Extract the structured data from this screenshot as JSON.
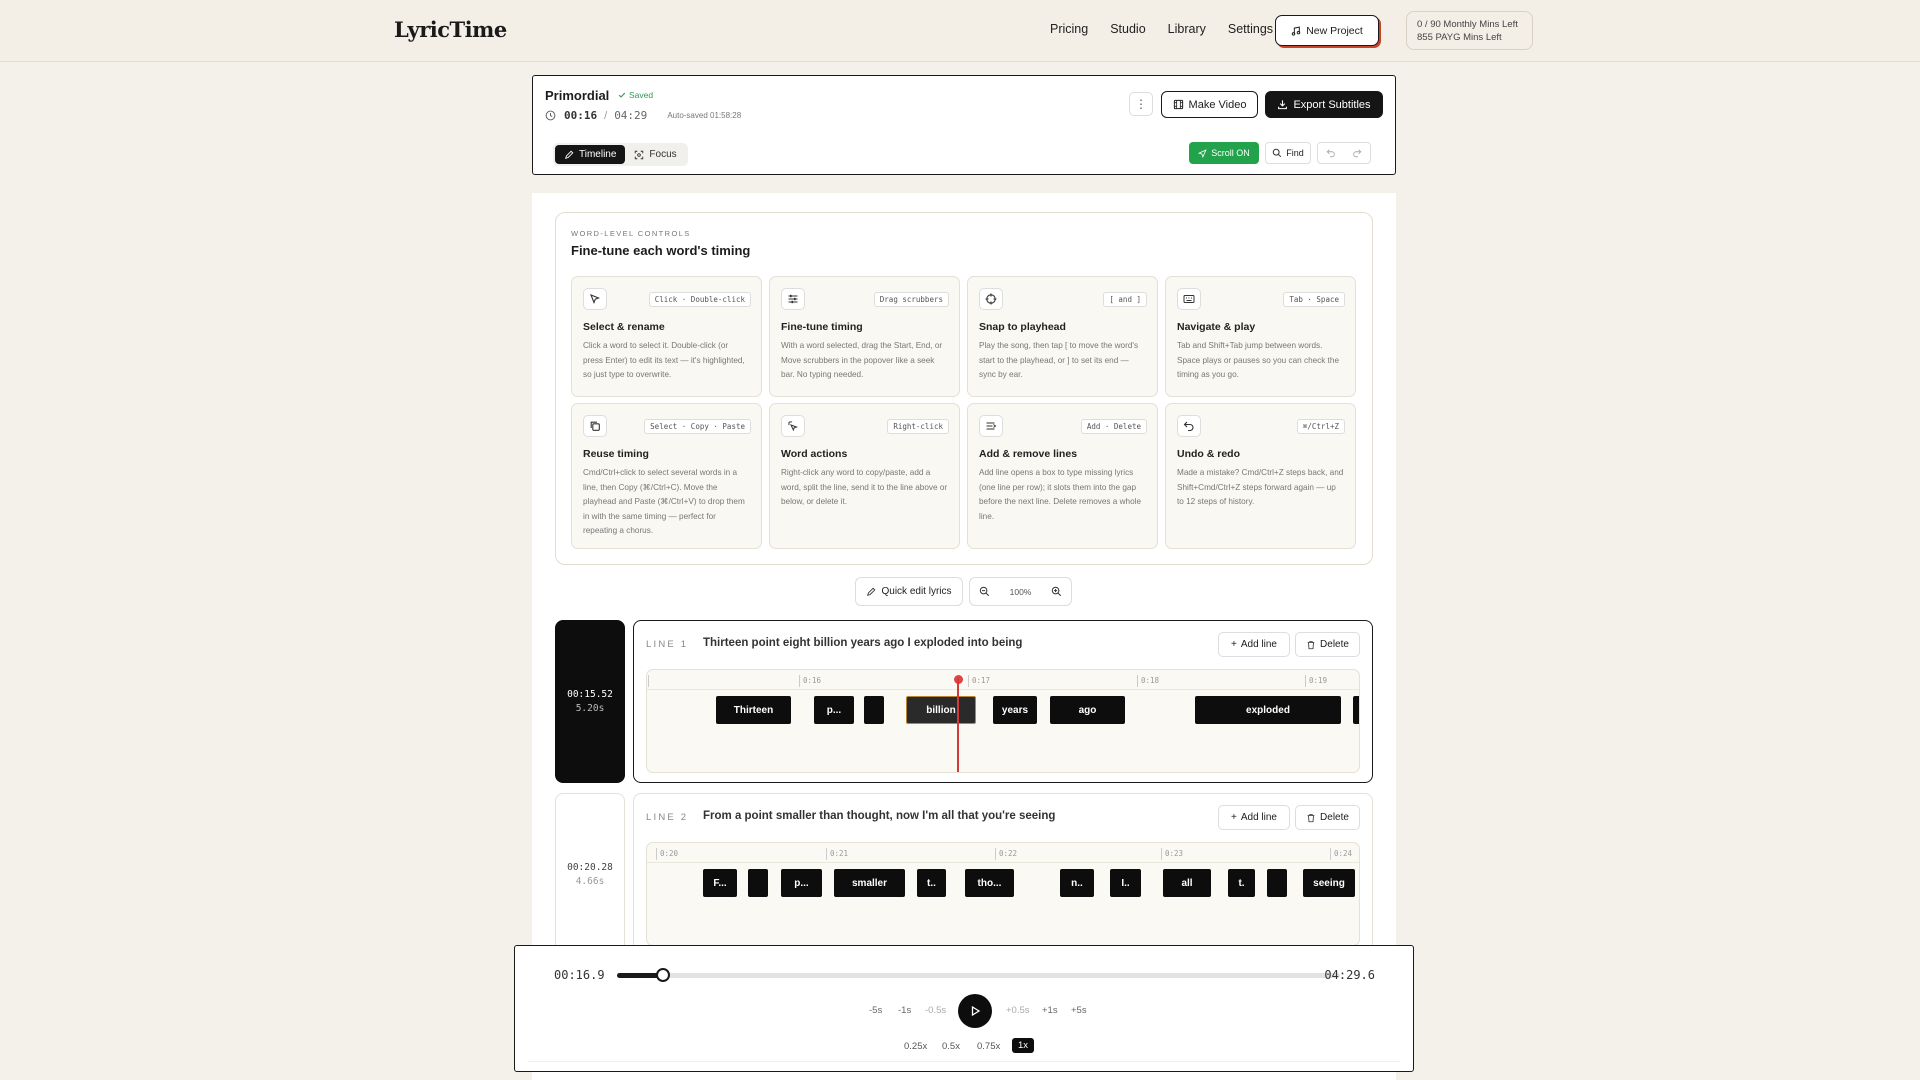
{
  "app": {
    "logo": "LyricTime"
  },
  "nav": {
    "links": [
      "Pricing",
      "Studio",
      "Library",
      "Settings"
    ],
    "new_project": "New Project",
    "mins_monthly": "0 / 90 Monthly Mins Left",
    "mins_payg": "855 PAYG Mins Left"
  },
  "project": {
    "title": "Primordial",
    "saved": "Saved",
    "current_time": "00:16",
    "separator": "/",
    "duration": "04:29",
    "autosaved": "Auto-saved 01:58:28"
  },
  "toolbar": {
    "make_video": "Make Video",
    "export": "Export Subtitles",
    "modes": [
      "Timeline",
      "Focus"
    ],
    "scroll": "Scroll  ON",
    "find": "Find"
  },
  "controls": {
    "eyebrow": "WORD-LEVEL CONTROLS",
    "title": "Fine-tune each word's timing",
    "tiles": [
      {
        "icon": "cursor-icon",
        "key": "Click · Double-click",
        "title": "Select & rename",
        "desc": "Click a word to select it. Double-click (or press Enter) to edit its text — it's highlighted, so just type to overwrite."
      },
      {
        "icon": "sliders-icon",
        "key": "Drag scrubbers",
        "title": "Fine-tune timing",
        "desc": "With a word selected, drag the Start, End, or Move scrubbers in the popover like a seek bar. No typing needed."
      },
      {
        "icon": "crosshair-icon",
        "key": "[ and ]",
        "title": "Snap to playhead",
        "desc": "Play the song, then tap [ to move the word's start to the playhead, or ] to set its end — sync by ear."
      },
      {
        "icon": "keyboard-icon",
        "key": "Tab · Space",
        "title": "Navigate & play",
        "desc": "Tab and Shift+Tab jump between words. Space plays or pauses so you can check the timing as you go."
      },
      {
        "icon": "copy-icon",
        "key": "Select · Copy · Paste",
        "title": "Reuse timing",
        "desc": "Cmd/Ctrl+click to select several words in a line, then Copy (⌘/Ctrl+C). Move the playhead and Paste (⌘/Ctrl+V) to drop them in with the same timing — perfect for repeating a chorus."
      },
      {
        "icon": "sparkle-icon",
        "key": "Right-click",
        "title": "Word actions",
        "desc": "Right-click any word to copy/paste, add a word, split the line, send it to the line above or below, or delete it."
      },
      {
        "icon": "list-plus-icon",
        "key": "Add · Delete",
        "title": "Add & remove lines",
        "desc": "Add line opens a box to type missing lyrics (one line per row); it slots them into the gap before the next line. Delete removes a whole line."
      },
      {
        "icon": "undo-icon",
        "key": "⌘/Ctrl+Z",
        "title": "Undo & redo",
        "desc": "Made a mistake? Cmd/Ctrl+Z steps back, and Shift+Cmd/Ctrl+Z steps forward again — up to 12 steps of history."
      }
    ]
  },
  "zoom": {
    "quick_edit": "Quick edit lyrics",
    "level": "100%"
  },
  "lines": [
    {
      "label": "LINE 1",
      "text": "Thirteen point eight billion years ago I exploded into being",
      "start": "00:15.52",
      "dur": "5.20s",
      "add": "Add line",
      "delete": "Delete",
      "ticks": [
        "0:16",
        "0:17",
        "0:18",
        "0:19"
      ],
      "words": [
        "Thirteen",
        "p...",
        "",
        "billion",
        "years",
        "ago",
        "exploded",
        ""
      ]
    },
    {
      "label": "LINE 2",
      "text": "From a point smaller than thought, now I'm all that you're seeing",
      "start": "00:20.28",
      "dur": "4.66s",
      "add": "Add line",
      "delete": "Delete",
      "ticks": [
        "0:20",
        "0:21",
        "0:22",
        "0:23",
        "0:24"
      ],
      "words": [
        "F...",
        "",
        "p...",
        "smaller",
        "t..",
        "tho...",
        "n..",
        "I..",
        "all",
        "t.",
        "",
        "seeing"
      ]
    }
  ],
  "player": {
    "current": "00:16.9",
    "duration": "04:29.6",
    "progress": 0.063,
    "seek": [
      "-5s",
      "-1s",
      "-0.5s",
      "+0.5s",
      "+1s",
      "+5s"
    ],
    "speeds": [
      "0.25x",
      "0.5x",
      "0.75x",
      "1x"
    ],
    "active_speed": "1x"
  }
}
